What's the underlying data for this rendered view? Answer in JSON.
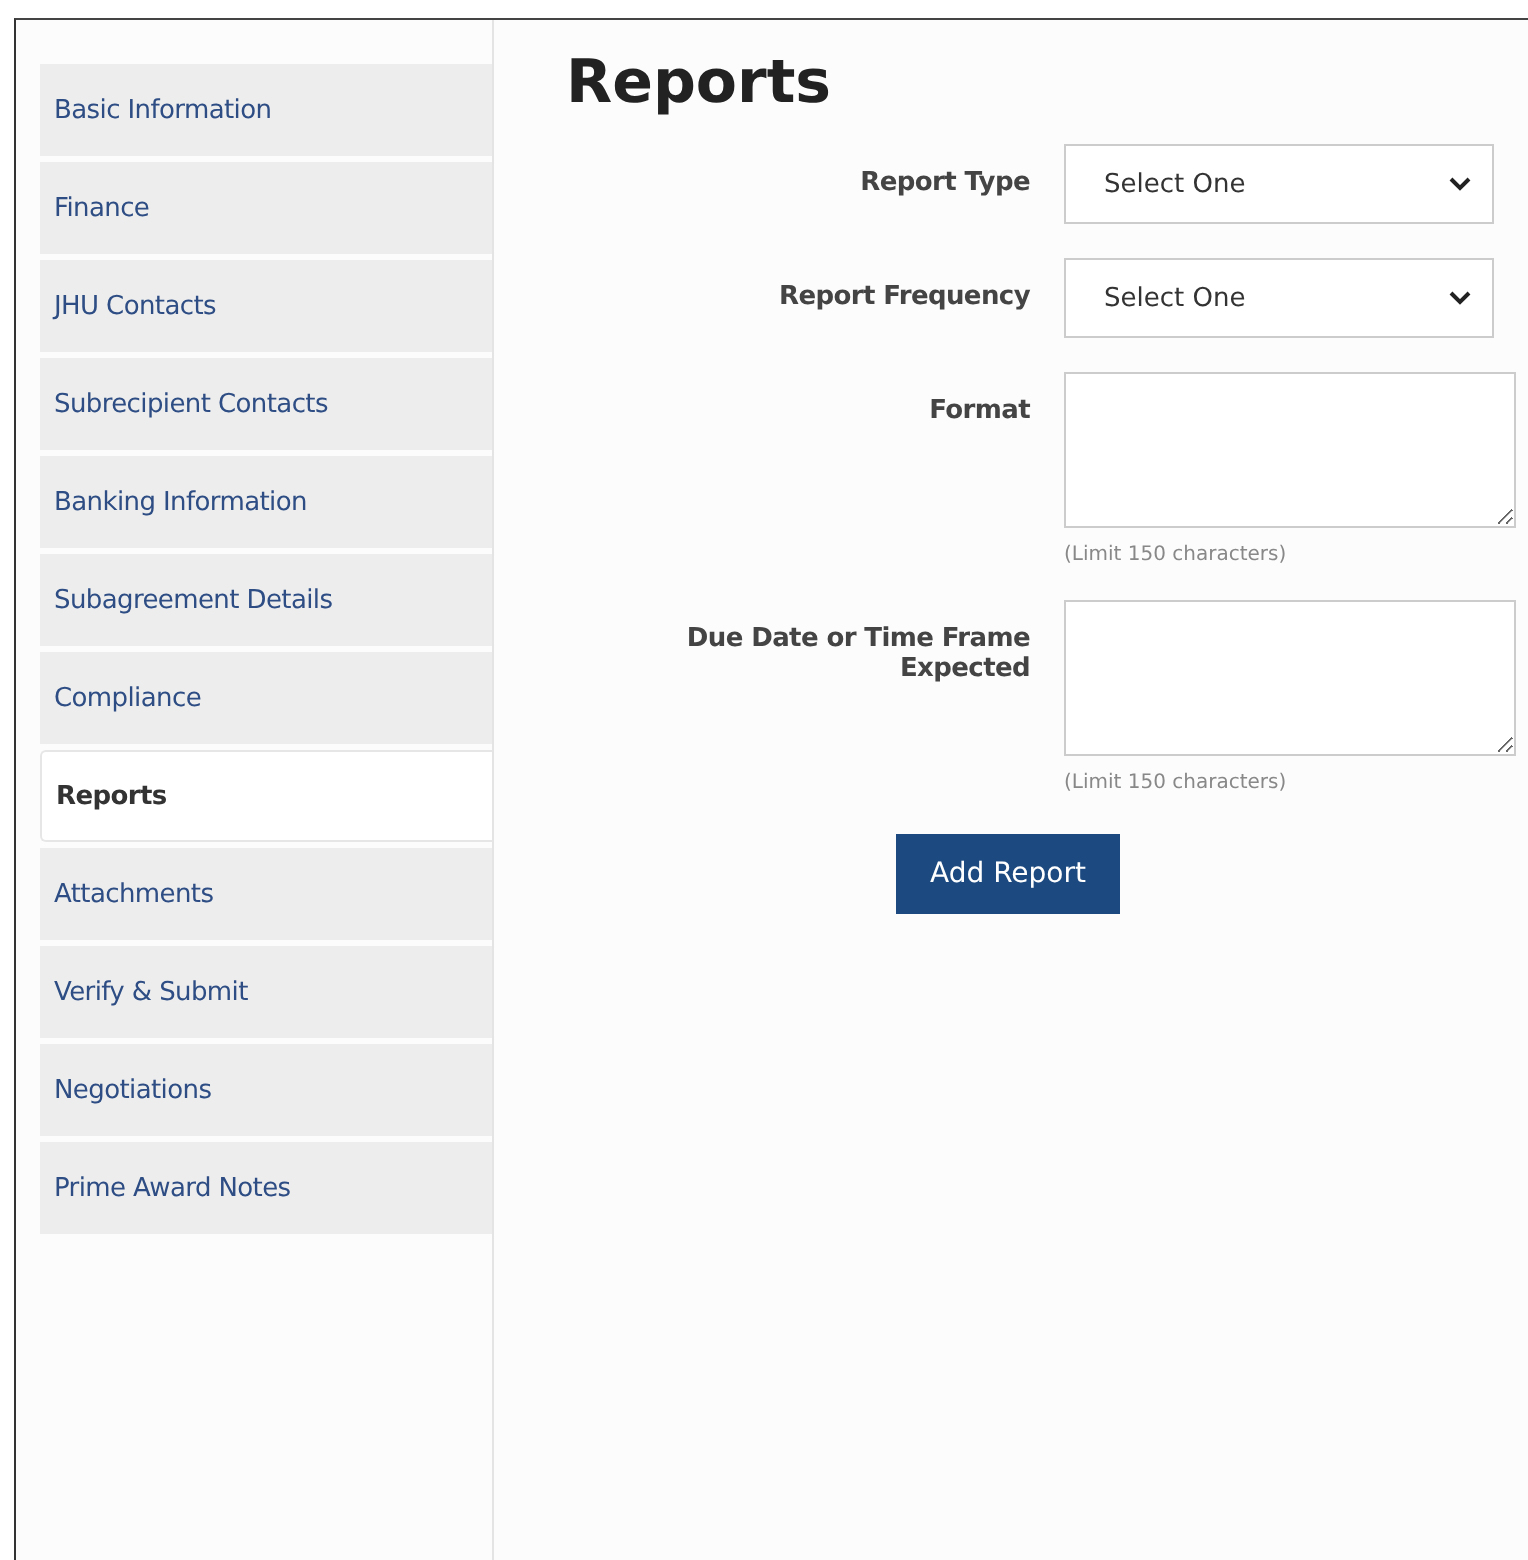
{
  "sidebar": {
    "items": [
      {
        "label": "Basic Information",
        "selected": false
      },
      {
        "label": "Finance",
        "selected": false
      },
      {
        "label": "JHU Contacts",
        "selected": false
      },
      {
        "label": "Subrecipient Contacts",
        "selected": false
      },
      {
        "label": "Banking Information",
        "selected": false
      },
      {
        "label": "Subagreement Details",
        "selected": false
      },
      {
        "label": "Compliance",
        "selected": false
      },
      {
        "label": "Reports",
        "selected": true
      },
      {
        "label": "Attachments",
        "selected": false
      },
      {
        "label": "Verify & Submit",
        "selected": false
      },
      {
        "label": "Negotiations",
        "selected": false
      },
      {
        "label": "Prime Award Notes",
        "selected": false
      }
    ]
  },
  "page_title": "Reports",
  "form": {
    "fields": [
      {
        "kind": "select",
        "label": "Report Type",
        "value": "Select One"
      },
      {
        "kind": "select",
        "label": "Report Frequency",
        "value": "Select One"
      },
      {
        "kind": "textarea",
        "label": "Format",
        "hint": "(Limit 150 characters)"
      },
      {
        "kind": "textarea",
        "label": "Due Date or Time Frame Expected",
        "hint": "(Limit 150 characters)"
      }
    ],
    "submit_button": "Add Report"
  }
}
